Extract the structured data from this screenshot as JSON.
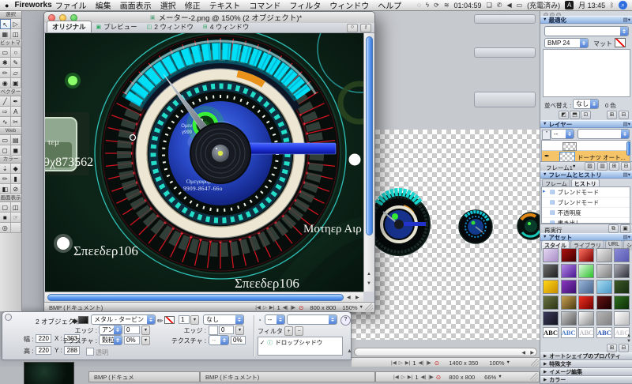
{
  "menu_bar": {
    "apple_label": "●",
    "app_name": "Fireworks",
    "items": [
      "ファイル",
      "編集",
      "画面表示",
      "選択",
      "修正",
      "テキスト",
      "コマンド",
      "フィルタ",
      "ウィンドウ",
      "ヘルプ"
    ],
    "status_items": [
      {
        "name": "universal-access-icon",
        "glyph": "◌",
        "type": "icon"
      },
      {
        "name": "battery-charging-icon",
        "glyph": "ϟ",
        "type": "icon"
      },
      {
        "name": "sync-icon",
        "glyph": "⟳",
        "type": "icon"
      },
      {
        "name": "airport-wifi-icon",
        "glyph": "≋",
        "type": "icon"
      },
      {
        "name": "timer",
        "glyph": "01:04:59",
        "type": "text"
      },
      {
        "name": "ichat-icon",
        "glyph": "❑",
        "type": "icon"
      },
      {
        "name": "phone-icon",
        "glyph": "✆",
        "type": "icon"
      },
      {
        "name": "volume-icon",
        "glyph": "◀",
        "type": "icon"
      },
      {
        "name": "battery-icon",
        "glyph": "▭",
        "type": "icon"
      },
      {
        "name": "battery-status",
        "glyph": "(充電済み)",
        "type": "text"
      },
      {
        "name": "input-menu-badge",
        "glyph": "A",
        "type": "badge"
      },
      {
        "name": "clock",
        "glyph": "月 13:45",
        "type": "text"
      },
      {
        "name": "bluetooth-icon",
        "glyph": "ᛒ",
        "type": "icon"
      },
      {
        "name": "spotlight-icon",
        "glyph": "⌕",
        "type": "spot"
      }
    ]
  },
  "toolbar": {
    "sections": [
      {
        "label": "選択",
        "tools": [
          {
            "name": "pointer-tool",
            "glyph": "↖",
            "active": true
          },
          {
            "name": "subselection-tool",
            "glyph": "▷"
          },
          {
            "name": "scale-tool",
            "glyph": "▦"
          },
          {
            "name": "crop-tool",
            "glyph": "◫"
          }
        ]
      },
      {
        "label": "ビットマップ",
        "tools": [
          {
            "name": "marquee-tool",
            "glyph": "▭"
          },
          {
            "name": "lasso-tool",
            "glyph": "○"
          },
          {
            "name": "magic-wand-tool",
            "glyph": "✱"
          },
          {
            "name": "brush-tool",
            "glyph": "✎"
          },
          {
            "name": "pencil-tool",
            "glyph": "✏"
          },
          {
            "name": "eraser-tool",
            "glyph": "▱"
          },
          {
            "name": "blur-tool",
            "glyph": "◉"
          },
          {
            "name": "rubber-stamp-tool",
            "glyph": "▣"
          }
        ]
      },
      {
        "label": "ベクター",
        "tools": [
          {
            "name": "line-tool",
            "glyph": "╱"
          },
          {
            "name": "pen-tool",
            "glyph": "✒"
          },
          {
            "name": "shape-tool",
            "glyph": "⇨"
          },
          {
            "name": "text-tool",
            "glyph": "A"
          },
          {
            "name": "freeform-tool",
            "glyph": "∿"
          },
          {
            "name": "knife-tool",
            "glyph": "✂"
          }
        ]
      },
      {
        "label": "Web",
        "tools": [
          {
            "name": "rectangle-hotspot-tool",
            "glyph": "▭"
          },
          {
            "name": "slice-tool",
            "glyph": "▤"
          },
          {
            "name": "hide-hotspots-button",
            "glyph": "◻"
          },
          {
            "name": "show-hotspots-button",
            "glyph": "◼"
          }
        ]
      },
      {
        "label": "カラー",
        "tools": [
          {
            "name": "eyedropper-tool",
            "glyph": "⇣"
          },
          {
            "name": "paint-bucket-tool",
            "glyph": "◆"
          },
          {
            "name": "stroke-color-well",
            "glyph": "✏"
          },
          {
            "name": "fill-color-well",
            "glyph": "▮"
          },
          {
            "name": "default-colors-button",
            "glyph": "◧"
          },
          {
            "name": "no-color-button",
            "glyph": "⊘"
          }
        ]
      },
      {
        "label": "画面表示",
        "tools": [
          {
            "name": "standard-screen-button",
            "glyph": "▢"
          },
          {
            "name": "full-screen-menus-button",
            "glyph": "◫"
          },
          {
            "name": "full-screen-button",
            "glyph": "■"
          },
          {
            "name": "hand-tool",
            "glyph": "☞"
          },
          {
            "name": "zoom-tool",
            "glyph": "◎"
          }
        ]
      }
    ]
  },
  "document_window": {
    "title": "メーター-2.png @ 150% (2 オブジェクト)*",
    "doc_icon": "▣",
    "tabs": [
      {
        "label": "オリジナル",
        "icon": ""
      },
      {
        "label": "プレビュー",
        "icon": "▣"
      },
      {
        "label": "2 ウィンドウ",
        "icon": "◫"
      },
      {
        "label": "4 ウィンドウ",
        "icon": "⊞"
      }
    ],
    "playback": [
      "|◀",
      "▷",
      "▶|",
      "1",
      "◀|",
      "|▶"
    ],
    "record_glyph": "⊙",
    "status_left": "BMP (ドキュメント)",
    "canvas_size": "800 x 800",
    "zoom": "150%"
  },
  "canvas_texts": {
    "badge_small": "τεμ",
    "badge_number": "9χ873562",
    "dial_small_1": "Ομεν",
    "dial_small_2": "γ999",
    "dial_label": "Ομεγαφοροστ",
    "dial_number": "9909-8647-66ο",
    "right_text": "Μοτηερ Αιρ",
    "bottom_left_text": "Σπεεδερ106",
    "bottom_center_text": "Σπεεδερ106"
  },
  "background_windows": {
    "window1": {
      "canvas_size": "1400 x 350",
      "zoom": "100%"
    },
    "window2": {
      "canvas_size": "800 x 800",
      "zoom": "66%"
    },
    "tab1": "BMP (ドキュメ",
    "tab2": "BMP (ドキュメント)"
  },
  "panels": {
    "optimize": {
      "title": "最適化",
      "settings_value": "",
      "format_value": "BMP 24",
      "matte_label": "マット :",
      "sort_label": "並べ替え :",
      "sort_value": "なし",
      "color_count": "0 色"
    },
    "layers": {
      "title": "レイヤー",
      "opacity_value": "--",
      "blend_value": "",
      "selected_layer": "ドーナツ オート...",
      "frame_label": "フレーム1"
    },
    "frames_history": {
      "title": "フレームとヒストリ",
      "tabs": [
        "フレーム",
        "ヒストリ"
      ],
      "items": [
        "ブレンドモード",
        "ブレンドモード",
        "不透明度",
        "書き出し"
      ],
      "redo_label": "再実行"
    },
    "assets": {
      "title": "アセット",
      "tabs": [
        "スタイル",
        "ライブラリ",
        "URL",
        "シェイプ"
      ],
      "swatches": [
        [
          [
            "#e6d9f2",
            "#a88cc8"
          ],
          [
            "#b01010",
            "#400000"
          ],
          [
            "#ff7060",
            "#7a0000"
          ],
          [
            "#ececec",
            "#9a9a9a"
          ],
          [
            "#8c8cd8",
            "#5858b0"
          ]
        ],
        [
          [
            "#707070",
            "#1e1e1e"
          ],
          [
            "#b488e8",
            "#4a1890"
          ],
          [
            "#e0f8e0",
            "#28c028"
          ],
          [
            "#d8d8d8",
            "#7c7c7c"
          ],
          [
            "#b0b0bc",
            "#2e2e38"
          ]
        ],
        [
          [
            "#ffd818",
            "#c88c00"
          ],
          [
            "#8c38c0",
            "#3c1070"
          ],
          [
            "#9ab4d8",
            "#46648c"
          ],
          [
            "#a8dcf0",
            "#4898c8"
          ],
          [
            "#3c5828",
            "#182c10"
          ]
        ],
        [
          [
            "#6a7442",
            "#2c3416"
          ],
          [
            "#c8a050",
            "#4c3c14"
          ],
          [
            "#f03020",
            "#700000"
          ],
          [
            "#681414",
            "#180000"
          ],
          [
            "#2e7020",
            "#0c2c08"
          ]
        ],
        [
          [
            "#3a3a5c",
            "#14141f"
          ],
          [
            "#cccccc",
            "#5c5c5c"
          ],
          [
            "#fbfbfb",
            "#8a8a8a"
          ],
          [
            "#b4b4b4",
            "#828282"
          ],
          [
            "#ffffff",
            "#bdbdbd"
          ]
        ]
      ],
      "abc_row": [
        {
          "label": "ABC",
          "color": "#101010",
          "bold": true
        },
        {
          "label": "ABC",
          "color": "#4a7ac8",
          "bold": true
        },
        {
          "label": "ABC",
          "color": "#9a9aa2",
          "bold": false
        },
        {
          "label": "ABC",
          "color": "#2a52b0",
          "bold": true
        },
        {
          "label": "ABC",
          "color": "#c9c9cf",
          "bold": true
        }
      ]
    },
    "collapsed_panels": [
      "オートシェイプのプロパティ",
      "特殊文字",
      "イメージ編集",
      "カラー"
    ]
  },
  "property_inspector": {
    "object_label": "2 オブジェクト",
    "w_label": "幅 :",
    "w_value": "220",
    "x_label": "X :",
    "x_value": "303",
    "h_label": "高 :",
    "h_value": "220",
    "y_label": "Y :",
    "y_value": "288",
    "fill_style": "メタル - タービン",
    "fill_edge_label": "エッジ :",
    "fill_edge_value": "アンチ…",
    "fill_edge_amount": "0",
    "fill_texture_label": "テクスチャ :",
    "fill_texture_value": "穀粒",
    "fill_texture_amount": "0%",
    "transparent_label": "透明",
    "stroke_tip": "1",
    "stroke_style": "なし",
    "stroke_edge_label": "エッジ :",
    "stroke_edge_amount": "0",
    "stroke_texture_label": "テクスチャ :",
    "stroke_texture_value": "--",
    "stroke_texture_amount": "0%",
    "filter_opacity": "--",
    "filter_label": "フィルタ :",
    "filter_item": "ドロップシャドウ",
    "help_glyph": "?"
  }
}
